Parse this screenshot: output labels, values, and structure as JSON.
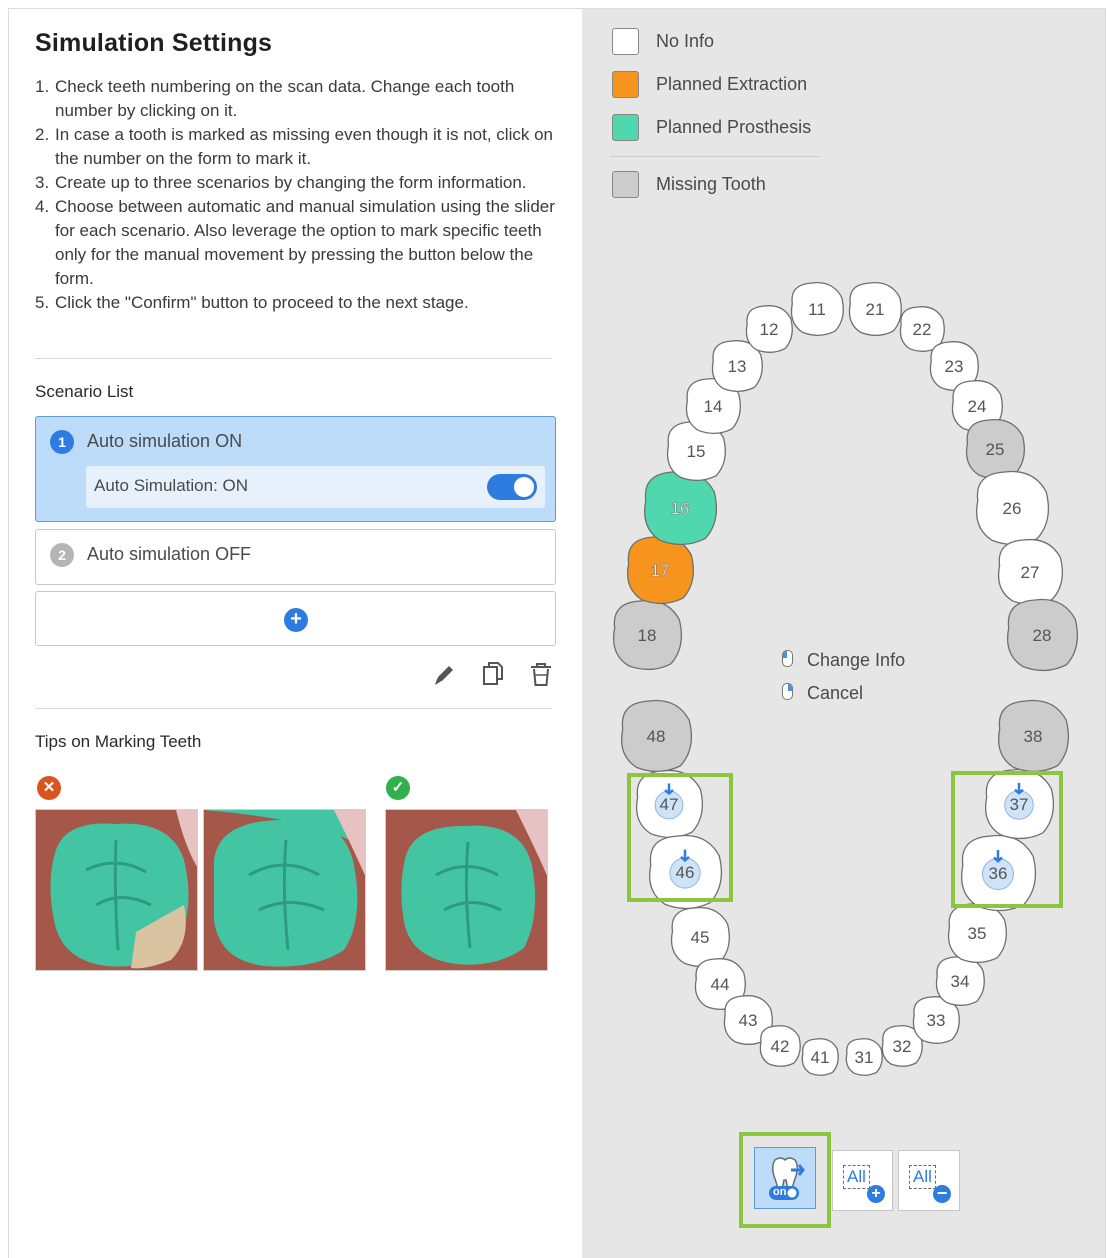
{
  "panel": {
    "title": "Simulation Settings",
    "instructions": [
      {
        "num": "1.",
        "text": "Check teeth numbering on the scan data. Change each tooth number by clicking on it."
      },
      {
        "num": "2.",
        "text": "In case a tooth is marked as missing even though it is not, click on the number on the form to mark it."
      },
      {
        "num": "3.",
        "text": "Create up to three scenarios by changing the form information."
      },
      {
        "num": "4.",
        "text": "Choose between automatic and manual simulation using the slider for each scenario. Also leverage the option to mark specific teeth only for the manual movement by pressing the button below the form."
      },
      {
        "num": "5.",
        "text": "Click the \"Confirm\" button to proceed to the next stage."
      }
    ],
    "scenario_list_label": "Scenario List",
    "scenarios": [
      {
        "badge": "1",
        "title": "Auto simulation ON",
        "toggle_label": "Auto Simulation: ON",
        "toggle_on": true,
        "active": true
      },
      {
        "badge": "2",
        "title": "Auto simulation OFF",
        "active": false
      }
    ],
    "add_scenario_icon": "plus-circle-icon",
    "actions": [
      "edit-icon",
      "copy-icon",
      "delete-icon"
    ],
    "tips_label": "Tips on Marking Teeth",
    "tips": {
      "incorrect_icon": "x-circle-icon",
      "correct_icon": "check-circle-icon",
      "incorrect_images": 2,
      "correct_images": 1
    }
  },
  "legend": [
    {
      "label": "No Info",
      "color": "#ffffff"
    },
    {
      "label": "Planned Extraction",
      "color": "#f7941d"
    },
    {
      "label": "Planned Prosthesis",
      "color": "#4fd8ad"
    },
    {
      "label": "Missing Tooth",
      "color": "#cccccc"
    }
  ],
  "hints": {
    "change_info": "Change Info",
    "cancel": "Cancel"
  },
  "teeth": {
    "upper": [
      "18",
      "17",
      "16",
      "15",
      "14",
      "13",
      "12",
      "11",
      "21",
      "22",
      "23",
      "24",
      "25",
      "26",
      "27",
      "28"
    ],
    "lower": [
      "48",
      "47",
      "46",
      "45",
      "44",
      "43",
      "42",
      "41",
      "31",
      "32",
      "33",
      "34",
      "35",
      "36",
      "37",
      "38"
    ],
    "status": {
      "17": "Planned Extraction",
      "16": "Planned Prosthesis",
      "18": "Missing Tooth",
      "25": "Missing Tooth",
      "28": "Missing Tooth",
      "48": "Missing Tooth",
      "38": "Missing Tooth"
    },
    "manual_movement_marked": [
      "47",
      "46",
      "37",
      "36"
    ]
  },
  "toolbar": {
    "manual_toggle_label": "on",
    "manual_toggle_icon": "tooth-manual-movement-icon",
    "all_add_label": "All",
    "all_remove_label": "All"
  },
  "colors": {
    "accent": "#2f7ce0",
    "highlight": "#8cc63e",
    "active_card": "#bcdcfa"
  }
}
